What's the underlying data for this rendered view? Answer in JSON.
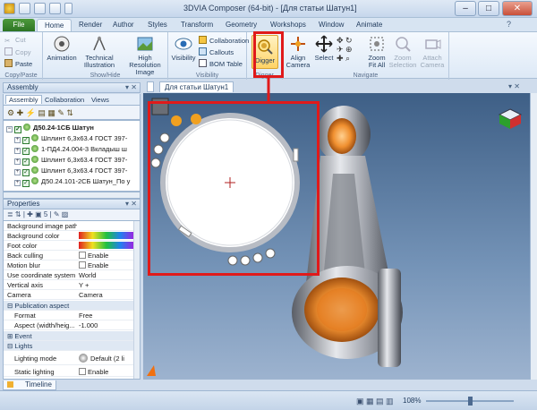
{
  "window": {
    "title": "3DVIA Composer (64-bit) - [Для статьи Шатун1]",
    "minimize": "–",
    "maximize": "□",
    "close": "✕"
  },
  "tabs": [
    "File",
    "Home",
    "Render",
    "Author",
    "Styles",
    "Transform",
    "Geometry",
    "Workshops",
    "Window",
    "Animate"
  ],
  "ribbon": {
    "clipboard": {
      "cut": "Cut",
      "copy": "Copy",
      "paste": "Paste",
      "label": "Copy/Paste"
    },
    "showhide": {
      "animation": "Animation",
      "technical": "Technical",
      "illustration": "Illustration",
      "highres": "High Resolution",
      "image": "Image",
      "label": "Show/Hide"
    },
    "visibility": {
      "visibility": "Visibility",
      "collaboration": "Collaboration",
      "callouts": "Callouts",
      "bom": "BOM Table",
      "label": "Visibility"
    },
    "digger": {
      "digger": "Digger",
      "label": "Digger"
    },
    "navigate": {
      "align": "Align",
      "camera": "Camera",
      "select": "Select",
      "zoom": "Zoom",
      "fitall": "Fit All",
      "zoomsel": "Zoom",
      "selection": "Selection",
      "attach": "Attach",
      "attachcam": "Camera",
      "label": "Navigate"
    }
  },
  "assembly": {
    "header": "Assembly",
    "tabs": [
      "Assembly",
      "Collaboration",
      "Views"
    ],
    "items": [
      {
        "label": "Д50.24-1СБ Шатун",
        "expand": "−"
      },
      {
        "label": "Шплинт 6,3х63.4 ГОСТ 397-",
        "expand": "+"
      },
      {
        "label": "1-ПД4.24.004-3 Вкладыш ш",
        "expand": "+"
      },
      {
        "label": "Шплинт 6,3х63.4 ГОСТ 397-",
        "expand": "+"
      },
      {
        "label": "Шплинт 6,3х63.4 ГОСТ 397-",
        "expand": "+"
      },
      {
        "label": "Д50.24.101-2СБ Шатун_По у",
        "expand": "+"
      }
    ]
  },
  "properties": {
    "header": "Properties",
    "rows": [
      {
        "name": "Background image path",
        "value": ""
      },
      {
        "name": "Background color",
        "value": ""
      },
      {
        "name": "Foot color",
        "value": ""
      },
      {
        "name": "Back culling",
        "value": "Enable"
      },
      {
        "name": "Motion blur",
        "value": "Enable"
      },
      {
        "name": "Use coordinate system",
        "value": "World"
      },
      {
        "name": "Vertical axis",
        "value": "Y +"
      },
      {
        "name": "Camera",
        "value": "Camera"
      }
    ],
    "section_pub": "Publication aspect",
    "rows2": [
      {
        "name": "Format",
        "value": "Free"
      },
      {
        "name": "Aspect (width/heig...",
        "value": "-1.000"
      }
    ],
    "section_event": "Event",
    "section_lights": "Lights",
    "rows3": [
      {
        "name": "Lighting mode",
        "value": "Default (2 li"
      },
      {
        "name": "Static lighting",
        "value": "Enable"
      }
    ]
  },
  "viewport": {
    "tab": "Для статьи Шатун1"
  },
  "timeline": {
    "label": "Timeline"
  },
  "status": {
    "zoom": "108%"
  },
  "colors": {
    "highlight": "#e01a1a",
    "accent": "#f0a020"
  }
}
